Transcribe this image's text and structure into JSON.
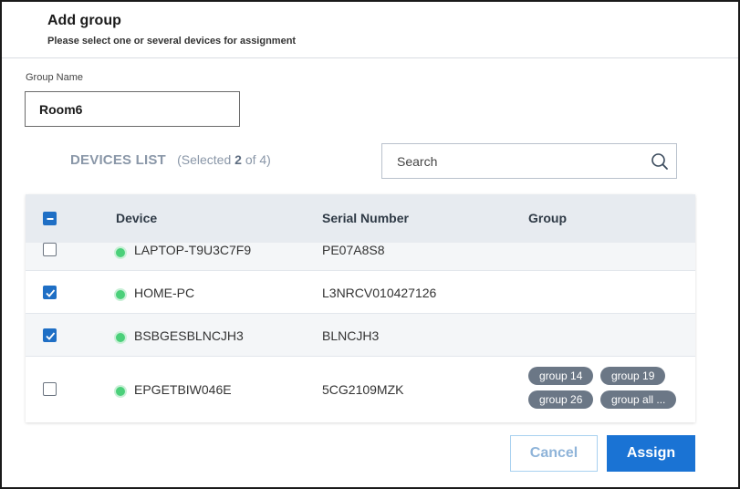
{
  "dialog": {
    "title": "Add group",
    "subtitle": "Please select one or several devices for assignment"
  },
  "group_name": {
    "label": "Group Name",
    "value": "Room6"
  },
  "devices_list": {
    "heading": "DEVICES LIST",
    "selected_prefix": "(Selected",
    "selected_count": "2",
    "selected_suffix": "of 4)"
  },
  "search": {
    "placeholder": "Search"
  },
  "table": {
    "columns": [
      "Device",
      "Serial Number",
      "Group"
    ],
    "select_all_state": "indeterminate",
    "rows": [
      {
        "checked": false,
        "status": "online",
        "device": "LAPTOP-T9U3C7F9",
        "serial": "PE07A8S8",
        "groups": []
      },
      {
        "checked": true,
        "status": "online",
        "device": "HOME-PC",
        "serial": "L3NRCV010427126",
        "groups": []
      },
      {
        "checked": true,
        "status": "online",
        "device": "BSBGESBLNCJH3",
        "serial": "BLNCJH3",
        "groups": []
      },
      {
        "checked": false,
        "status": "online",
        "device": "EPGETBIW046E",
        "serial": "5CG2109MZK",
        "groups": [
          "group 14",
          "group 19",
          "group 26",
          "group all ..."
        ]
      }
    ]
  },
  "buttons": {
    "cancel": "Cancel",
    "assign": "Assign"
  },
  "colors": {
    "accent": "#1a73d4",
    "checkbox_checked": "#1f6fc5",
    "status_online": "#4bd07a",
    "tag_bg": "#6b7786",
    "header_bg": "#e7ebf0"
  }
}
